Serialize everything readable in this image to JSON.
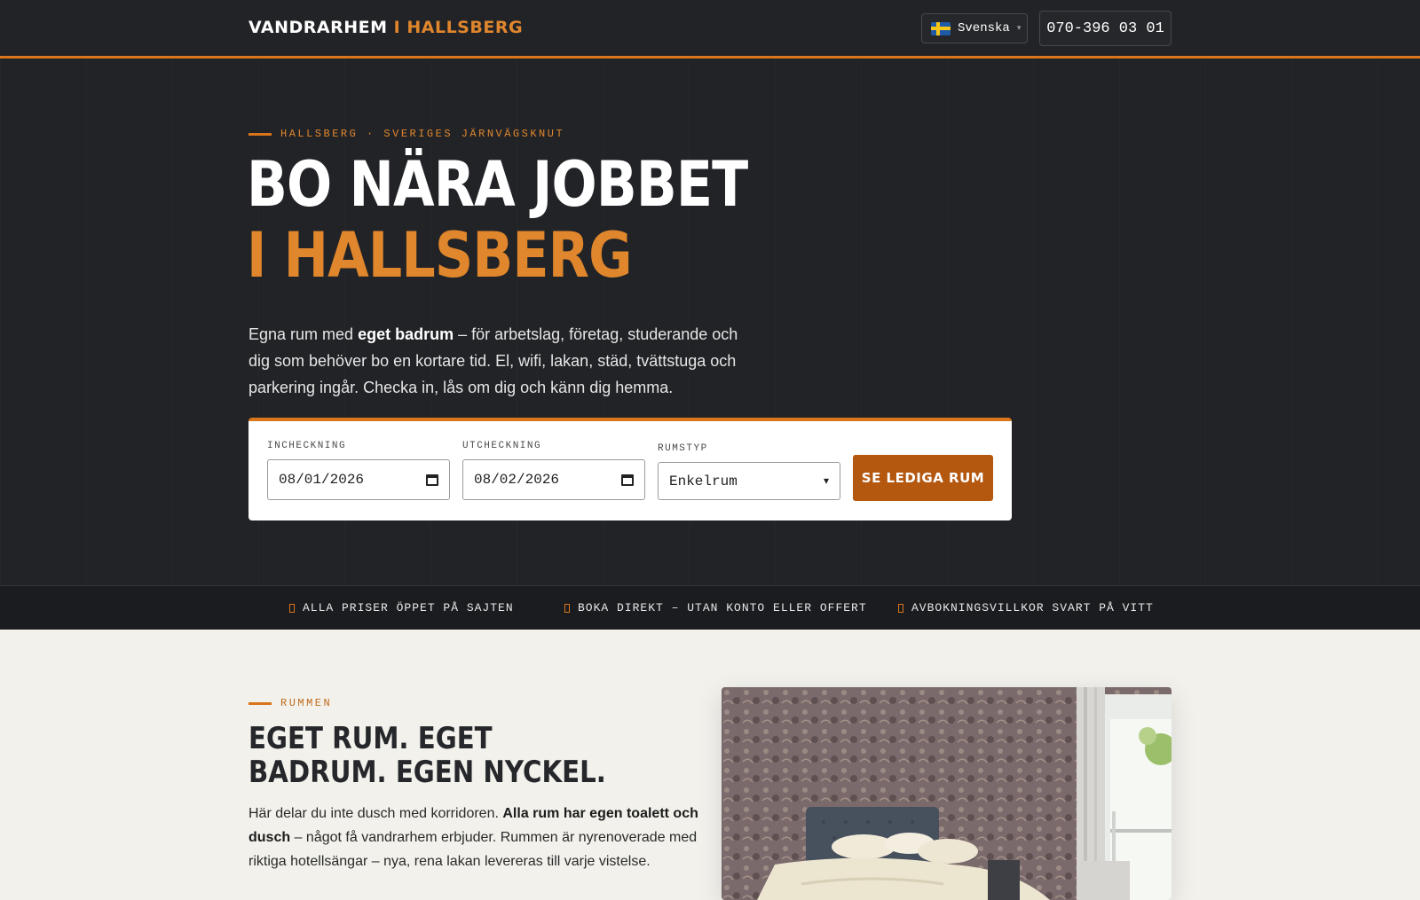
{
  "header": {
    "brand_main": "VANDRARHEM",
    "brand_accent": "I HALLSBERG",
    "language": "Svenska",
    "language_caret": "▾",
    "phone": "070-396 03 01"
  },
  "hero": {
    "eyebrow": "HALLSBERG · SVERIGES JÄRNVÄGSKNUT",
    "title_line1": "BO NÄRA JOBBET",
    "title_line2": "I HALLSBERG",
    "lead_pre": "Egna rum med ",
    "lead_bold": "eget badrum",
    "lead_post": " – för arbetslag, företag, studerande och dig som behöver bo en kortare tid. El, wifi, lakan, städ, tvättstuga och parkering ingår. Checka in, lås om dig och känn dig hemma."
  },
  "booking": {
    "checkin_label": "INCHECKNING",
    "checkin_value": "08/01/2026",
    "checkout_label": "UTCHECKNING",
    "checkout_value": "08/02/2026",
    "roomtype_label": "RUMSTYP",
    "roomtype_value": "Enkelrum",
    "submit_label": "SE LEDIGA RUM"
  },
  "trust": {
    "items": [
      "ALLA PRISER ÖPPET PÅ SAJTEN",
      "BOKA DIREKT – UTAN KONTO ELLER OFFERT",
      "AVBOKNINGSVILLKOR SVART PÅ VITT"
    ]
  },
  "rooms": {
    "eyebrow": "RUMMEN",
    "title_line1": "EGET RUM. EGET",
    "title_line2": "BADRUM. EGEN NYCKEL.",
    "body_pre": "Här delar du inte dusch med korridoren. ",
    "body_bold": "Alla rum har egen toalett och dusch",
    "body_post": " – något få vandrarhem erbjuder. Rummen är nyrenoverade med riktiga hotellsängar – nya, rena lakan levereras till varje vistelse."
  },
  "colors": {
    "accent": "#d9751b",
    "dark": "#222327",
    "button": "#b4570f"
  },
  "icons": [
    "swedish-flag-icon",
    "calendar-icon",
    "check-icon"
  ]
}
